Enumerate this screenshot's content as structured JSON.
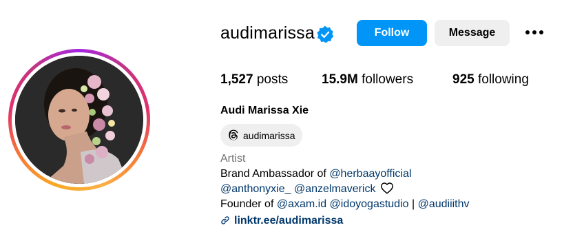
{
  "profile": {
    "username": "audimarissa",
    "verified": true,
    "follow_label": "Follow",
    "message_label": "Message",
    "stats": {
      "posts_count": "1,527",
      "posts_label": "posts",
      "followers_count": "15.9M",
      "followers_label": "followers",
      "following_count": "925",
      "following_label": "following"
    },
    "full_name": "Audi Marissa Xie",
    "threads_handle": "audimarissa",
    "category": "Artist",
    "bio": {
      "line1_prefix": "Brand Ambassador of ",
      "line1_tag": "@herbaayofficial",
      "line2_tag1": "@anthonyxie_",
      "line2_tag2": "@anzelmaverick",
      "line3_prefix": "Founder of ",
      "line3_tag1": "@axam.id",
      "line3_tag2": "@idoyogastudio",
      "line3_sep": " | ",
      "line3_tag3": "@audiiithv"
    },
    "link_text": "linktr.ee/audimarissa"
  },
  "colors": {
    "primary_button": "#0095f6",
    "secondary_button": "#efefef",
    "link": "#00376b",
    "muted_text": "#737373",
    "verified_badge": "#0095f6"
  },
  "icons": [
    "verified-badge-icon",
    "more-options-icon",
    "threads-icon",
    "heart-outline-icon",
    "link-icon"
  ]
}
